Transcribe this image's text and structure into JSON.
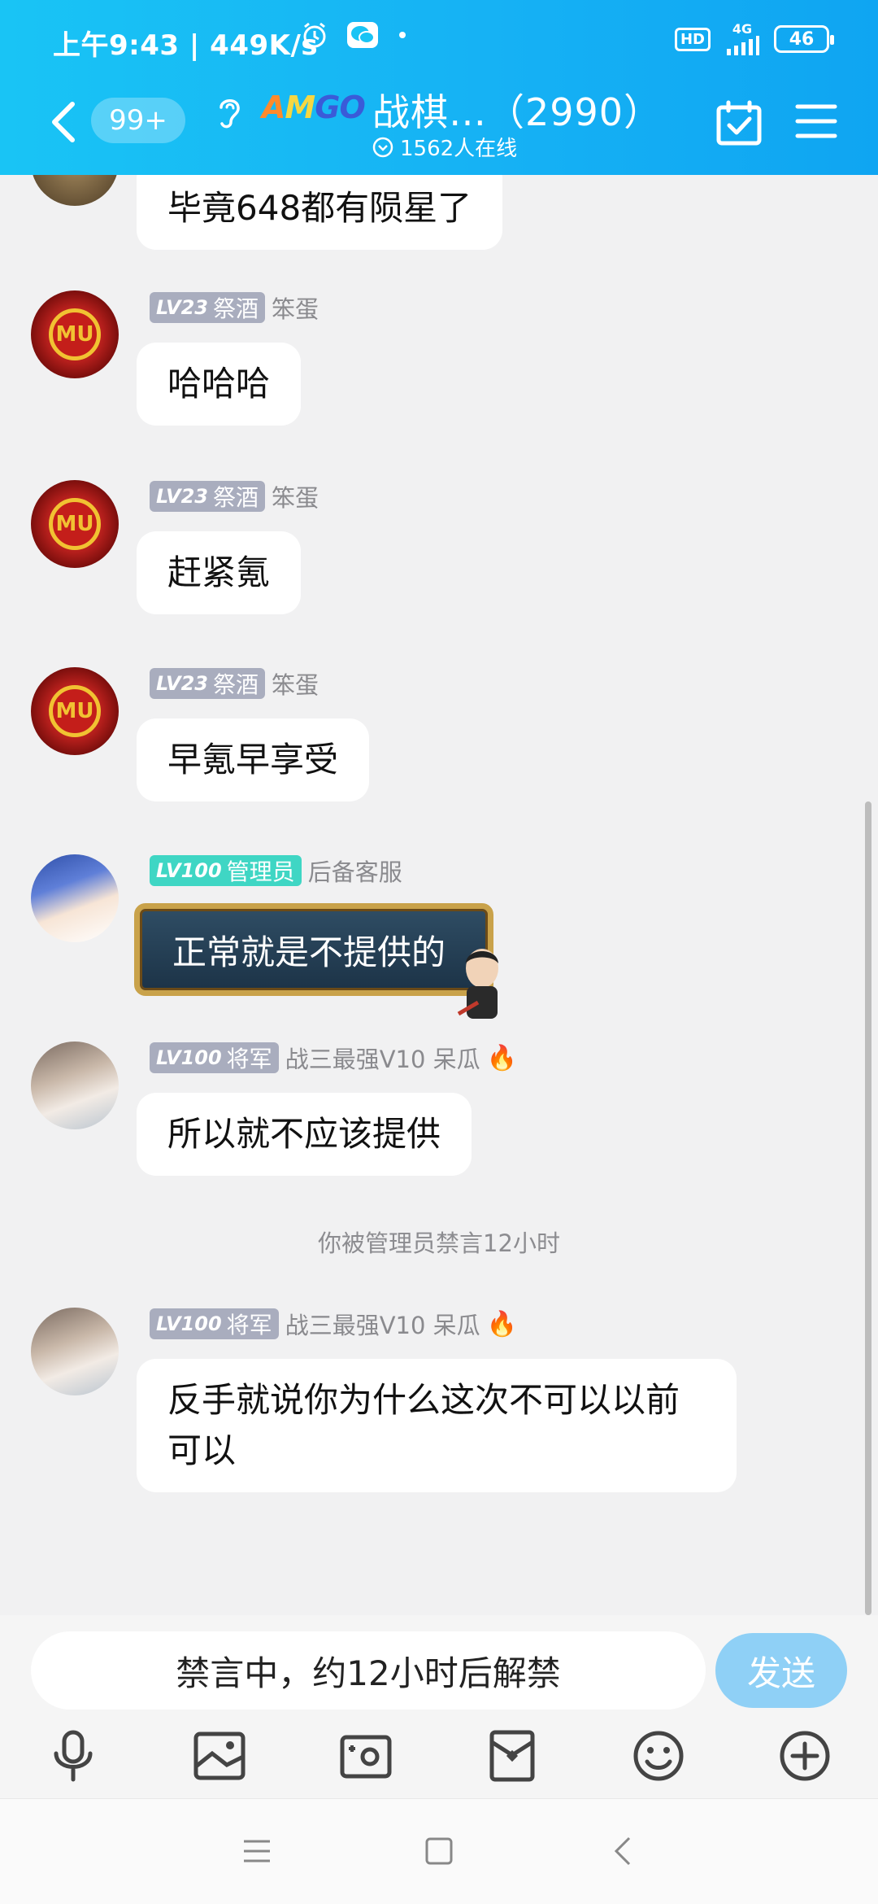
{
  "status_bar": {
    "time": "上午9:43 | 449K/s",
    "hd": "HD",
    "network": "4G",
    "battery": "46"
  },
  "header": {
    "unread_count": "99+",
    "group_logo": "AMGO",
    "group_title": "战棋…（2990）",
    "online": "1562人在线"
  },
  "messages": [
    {
      "text": "毕竟648都有陨星了"
    },
    {
      "level": "LV23",
      "rank": "祭酒",
      "sender": "笨蛋",
      "text": "哈哈哈"
    },
    {
      "level": "LV23",
      "rank": "祭酒",
      "sender": "笨蛋",
      "text": "赶紧氪"
    },
    {
      "level": "LV23",
      "rank": "祭酒",
      "sender": "笨蛋",
      "text": "早氪早享受"
    },
    {
      "level": "LV100",
      "rank": "管理员",
      "sender": "后备客服",
      "text": "正常就是不提供的"
    },
    {
      "level": "LV100",
      "rank": "将军",
      "sender": "战三最强V10 呆瓜",
      "text": "所以就不应该提供"
    },
    {
      "level": "LV100",
      "rank": "将军",
      "sender": "战三最强V10 呆瓜",
      "text": "反手就说你为什么这次不可以以前可以"
    }
  ],
  "system_message": "你被管理员禁言12小时",
  "input": {
    "placeholder": "禁言中，约12小时后解禁",
    "send_label": "发送"
  },
  "colors": {
    "header_gradient_start": "#19c4f5",
    "header_gradient_end": "#0fa5f2",
    "admin_badge": "#3fd6c4",
    "level_badge": "#a9adbe",
    "send_button": "#8fd0f6"
  }
}
